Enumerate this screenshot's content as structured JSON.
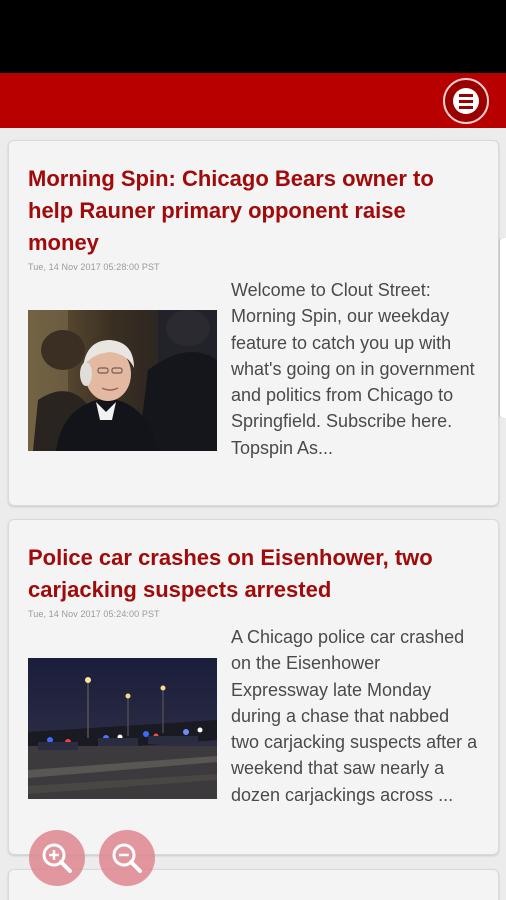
{
  "app_bar": {
    "menu_icon": "menu-icon",
    "color": "#b80000"
  },
  "articles": [
    {
      "title": "Morning Spin: Chicago Bears owner to help Rauner primary opponent raise money",
      "date": "Tue, 14 Nov 2017 05:28:00 PST",
      "excerpt": "Welcome to Clout Street: Morning Spin, our weekday feature to catch you up with what's going on in government and politics from Chicago to Springfield. Subscribe here.  Topspin As...",
      "image": "photo-elderly-woman"
    },
    {
      "title": "Police car crashes on Eisenhower, two carjacking suspects arrested",
      "date": "Tue, 14 Nov 2017 05:24:00 PST",
      "excerpt": "A Chicago police car crashed on the Eisenhower Expressway late Monday during a chase that nabbed two carjacking suspects after a weekend that saw nearly a dozen carjackings across ...",
      "image": "photo-expressway-night"
    }
  ],
  "zoom": {
    "zoom_in_icon": "zoom-in-icon",
    "zoom_out_icon": "zoom-out-icon"
  },
  "colors": {
    "title": "#a00a0a",
    "accent": "#b80000"
  }
}
